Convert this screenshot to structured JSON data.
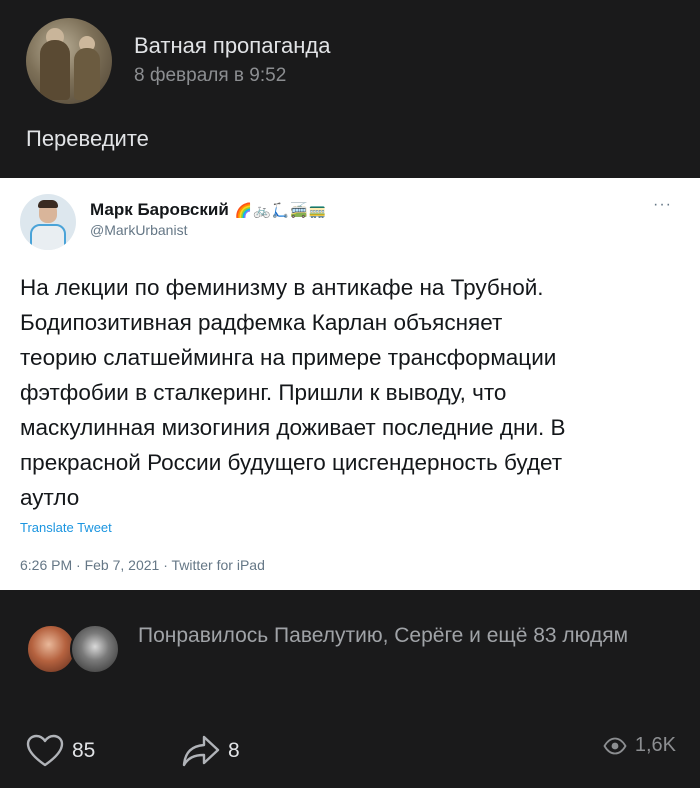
{
  "header": {
    "group_name": "Ватная пропаганда",
    "date": "8 февраля в 9:52"
  },
  "post_text": "Переведите",
  "tweet": {
    "name": "Марк Баровский",
    "emoji": "🌈🚲🛴🚎🚃",
    "handle": "@MarkUrbanist",
    "more": "···",
    "body": "На лекции по феминизму в антикафе на Трубной.\nБодипозитивная радфемка Карлан объясняет\nтеорию слатшейминга на примере трансформации\nфэтфобии в сталкеринг. Пришли к выводу, что\nмаскулинная мизогиния доживает последние дни. В\nпрекрасной России будущего цисгендерность будет\nаутло",
    "translate": "Translate Tweet",
    "meta": "6:26 PM · Feb 7, 2021 · Twitter for iPad"
  },
  "likes": {
    "text": "Понравилось Павелутию, Серёге и ещё 83 людям"
  },
  "actions": {
    "like_count": "85",
    "share_count": "8",
    "views_count": "1,6K"
  },
  "icons": {
    "like": "heart-icon",
    "share": "share-arrow-icon",
    "views": "eye-icon",
    "more": "ellipsis-icon"
  },
  "colors": {
    "background": "#1a1a1b",
    "text": "#e1e3e6",
    "secondary": "#8c8e91",
    "tweet_link": "#1b95e0"
  }
}
